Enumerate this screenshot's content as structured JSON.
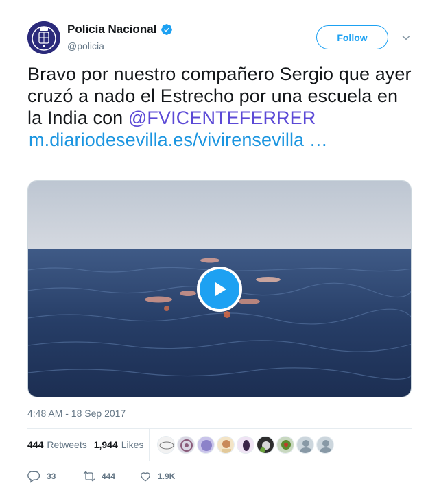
{
  "author": {
    "name": "Policía Nacional",
    "handle": "@policia",
    "verified": true
  },
  "follow_label": "Follow",
  "tweet": {
    "text": "Bravo por nuestro compañero Sergio que ayer cruzó a nado el Estrecho por una escuela en la India con",
    "mention": "@FVICENTEFERRER",
    "url": "m.diariodesevilla.es/vivirensevilla",
    "ellipsis": "…"
  },
  "video": {
    "description": "Open-water swimmers in the sea"
  },
  "timestamp": "4:48 AM - 18 Sep 2017",
  "stats": {
    "retweets_count": "444",
    "retweets_label": "Retweets",
    "likes_count": "1,944",
    "likes_label": "Likes"
  },
  "actions": {
    "reply_count": "33",
    "retweet_count": "444",
    "like_count": "1.9K"
  },
  "colors": {
    "accent": "#1da1f2",
    "mention": "#5b49d6",
    "link": "#1b95e0",
    "muted": "#657786",
    "verified": "#1da1f2",
    "avatar_bg": "#2b2a7b"
  }
}
